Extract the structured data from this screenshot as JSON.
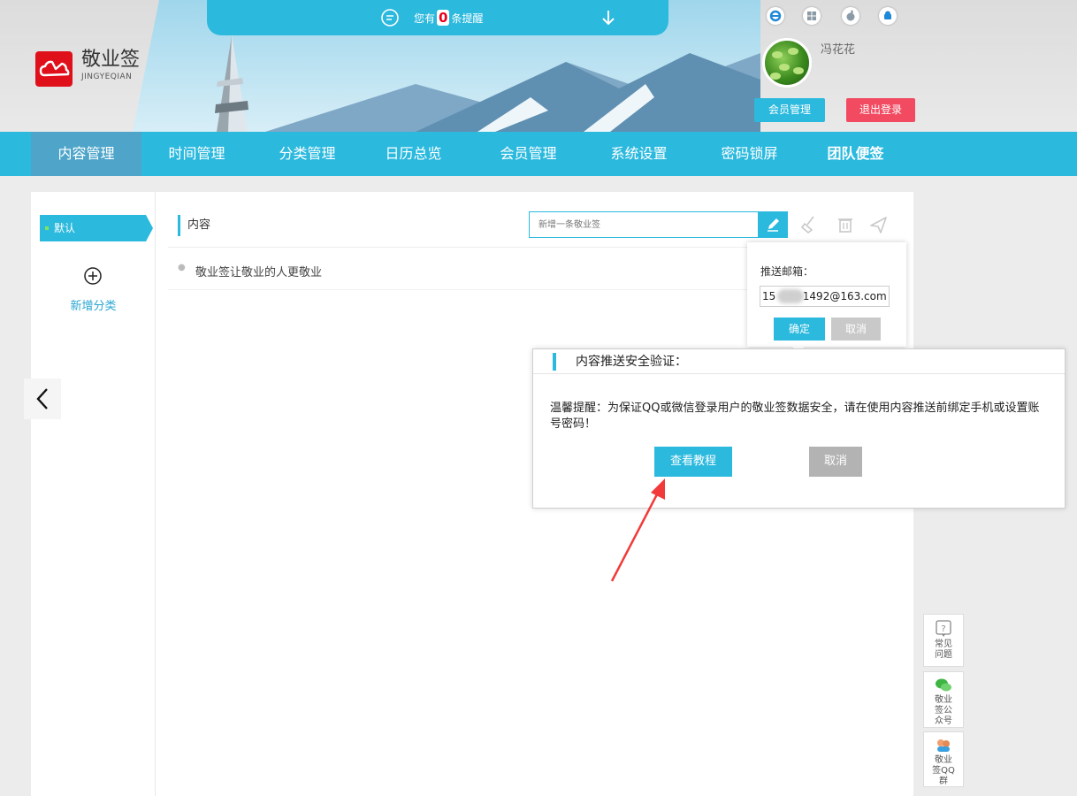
{
  "notice": {
    "prefix": "您有",
    "count": "0",
    "suffix": "条提醒"
  },
  "brand": {
    "name": "敬业签",
    "sub": "JINGYEQIAN"
  },
  "user": {
    "name": "冯花花",
    "member_button": "会员管理",
    "logout_button": "退出登录"
  },
  "nav": {
    "items": [
      {
        "label": "内容管理"
      },
      {
        "label": "时间管理"
      },
      {
        "label": "分类管理"
      },
      {
        "label": "日历总览"
      },
      {
        "label": "会员管理"
      },
      {
        "label": "系统设置"
      },
      {
        "label": "密码锁屏"
      },
      {
        "label": "团队便签"
      }
    ]
  },
  "sidebar": {
    "default_category": "默认",
    "add_category": "新增分类"
  },
  "content": {
    "heading": "内容",
    "search_placeholder": "新增一条敬业签",
    "notes": [
      {
        "text": "敬业签让敬业的人更敬业"
      }
    ]
  },
  "push_popover": {
    "label": "推送邮箱：",
    "email_value": "15        1492@163.com",
    "ok": "确定",
    "cancel": "取消"
  },
  "dialog": {
    "title": "内容推送安全验证：",
    "message": "温馨提醒：为保证QQ或微信登录用户的敬业签数据安全，请在使用内容推送前绑定手机或设置账号密码！",
    "tutorial_button": "查看教程",
    "cancel_button": "取消"
  },
  "side": {
    "faq": "常见问题",
    "wechat": "敬业签公众号",
    "qq_group": "敬业签QQ群"
  },
  "colors": {
    "accent": "#2bb9de",
    "danger": "#f14a61",
    "brand": "#e0101b",
    "annotation": "#f23a3a"
  }
}
